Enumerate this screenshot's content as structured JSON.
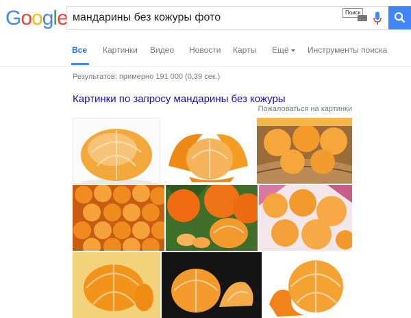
{
  "logo": "Google",
  "search": {
    "query": "мандарины без кожуры фото",
    "tooltip": "Поиск"
  },
  "tabs": [
    {
      "label": "Все",
      "active": true
    },
    {
      "label": "Картинки"
    },
    {
      "label": "Видео"
    },
    {
      "label": "Новости"
    },
    {
      "label": "Карты"
    },
    {
      "label": "Ещё"
    },
    {
      "label": "Инструменты поиска"
    }
  ],
  "results": {
    "stats": "Результатов: примерно 191 000 (0,39 сек.)",
    "images_heading": "Картинки по запросу мандарины без кожуры",
    "report_link": "Пожаловаться на картинки"
  },
  "colors": {
    "accent": "#4285f4",
    "link": "#1a0dab",
    "logo": [
      "#4285f4",
      "#ea4335",
      "#fbbc05",
      "#4285f4",
      "#34a853",
      "#ea4335"
    ]
  }
}
